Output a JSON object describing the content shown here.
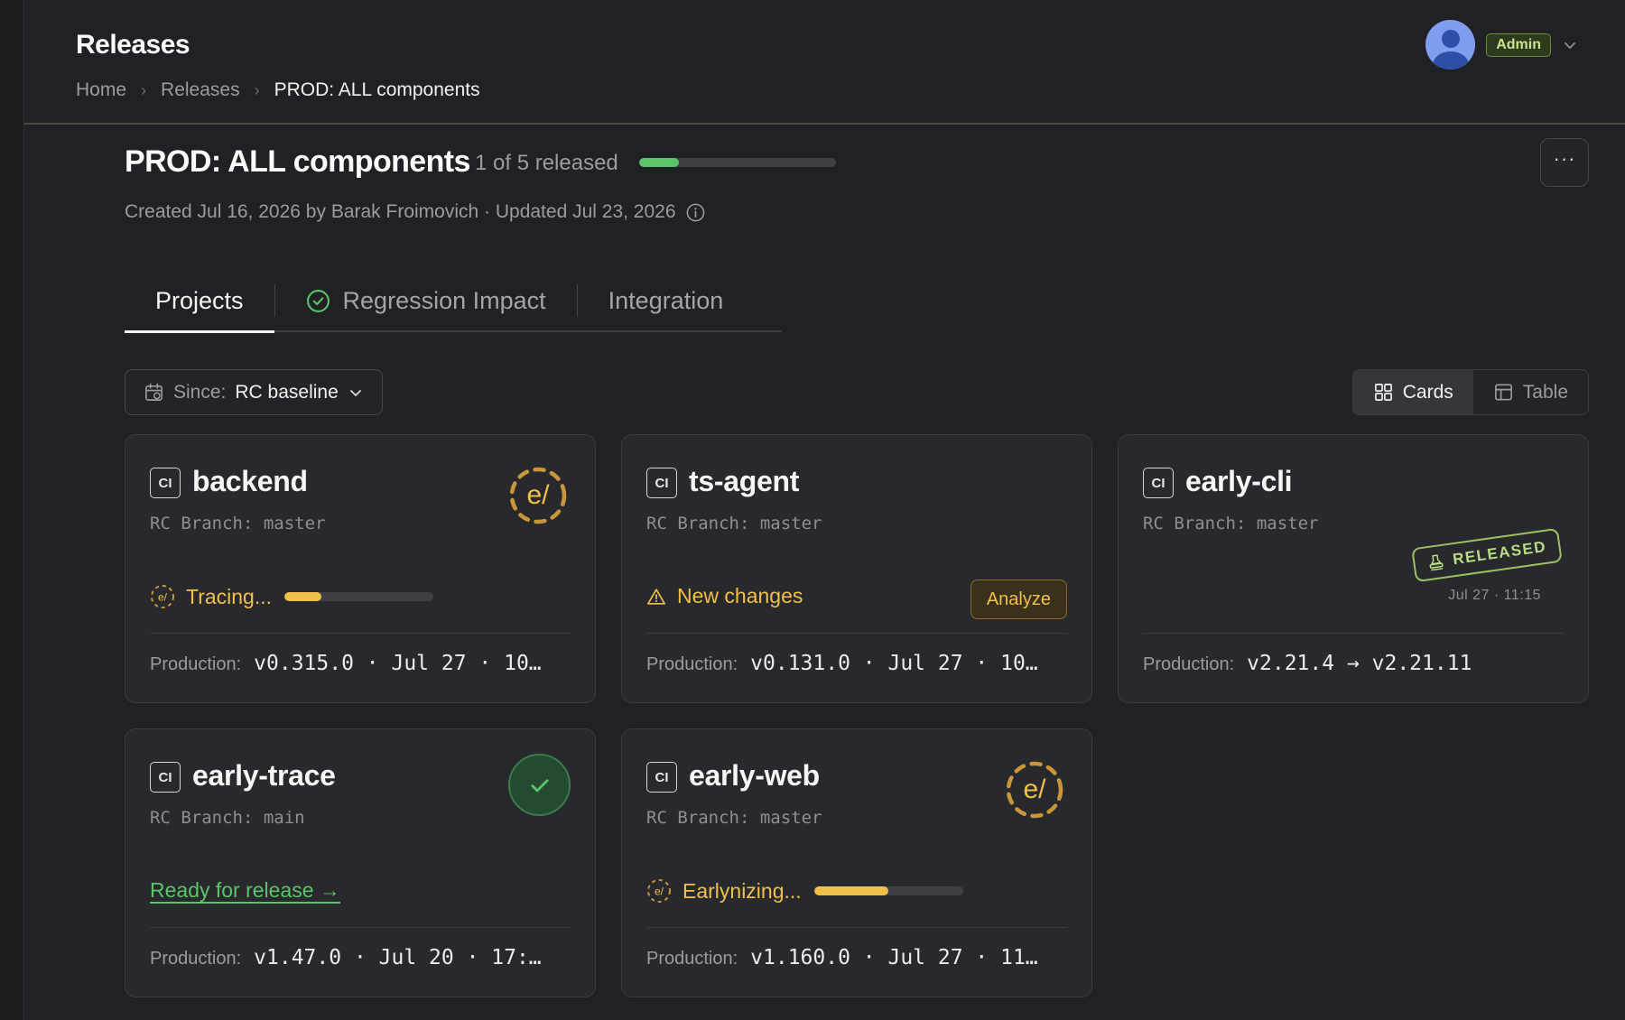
{
  "header": {
    "app_title": "Releases",
    "breadcrumb": [
      "Home",
      "Releases",
      "PROD: ALL components"
    ],
    "user": {
      "role_badge": "Admin"
    }
  },
  "release": {
    "title": "PROD: ALL components",
    "count_text": "1 of 5 released",
    "progress_fraction": 0.2,
    "meta": "Created Jul 16, 2026 by Barak Froimovich · Updated Jul 23, 2026",
    "more_label": "···"
  },
  "tabs": [
    {
      "label": "Projects",
      "active": true
    },
    {
      "label": "Regression Impact",
      "active": false
    },
    {
      "label": "Integration",
      "active": false
    }
  ],
  "filter": {
    "label": "Since:",
    "value": "RC baseline"
  },
  "view_toggle": [
    {
      "label": "Cards",
      "active": true
    },
    {
      "label": "Table",
      "active": false
    }
  ],
  "cards": [
    {
      "badge": "CI",
      "name": "backend",
      "branch": "RC Branch: master",
      "status": "Tracing...",
      "progress_fraction": 0.25,
      "production_label": "Production:",
      "production_value": "v0.315.0 · Jul 27 · 10…",
      "icon": "early-logo-icon"
    },
    {
      "badge": "CI",
      "name": "ts-agent",
      "branch": "RC Branch: master",
      "status": "New changes",
      "action": "Analyze",
      "production_label": "Production:",
      "production_value": "v0.131.0 · Jul 27 · 10…",
      "icon": "warning-icon"
    },
    {
      "badge": "CI",
      "name": "early-cli",
      "branch": "RC Branch: master",
      "stamp": "RELEASED",
      "stamp_date": "Jul 27 · 11:15",
      "production_label": "Production:",
      "production_value": "v2.21.4 → v2.21.11",
      "icon": "stamp-icon"
    },
    {
      "badge": "CI",
      "name": "early-trace",
      "branch": "RC Branch: main",
      "status": "Ready for release →",
      "production_label": "Production:",
      "production_value": "v1.47.0 · Jul 20 · 17:…",
      "icon": "check-icon"
    },
    {
      "badge": "CI",
      "name": "early-web",
      "branch": "RC Branch: master",
      "status": "Earlynizing...",
      "progress_fraction": 0.5,
      "production_label": "Production:",
      "production_value": "v1.160.0 · Jul 27 · 11…",
      "icon": "early-logo-icon"
    }
  ],
  "colors": {
    "background": "#202124",
    "card": "#28292c",
    "accent_green": "#5ac469",
    "accent_amber": "#f0c04a",
    "stamp_green": "#9bc164"
  }
}
